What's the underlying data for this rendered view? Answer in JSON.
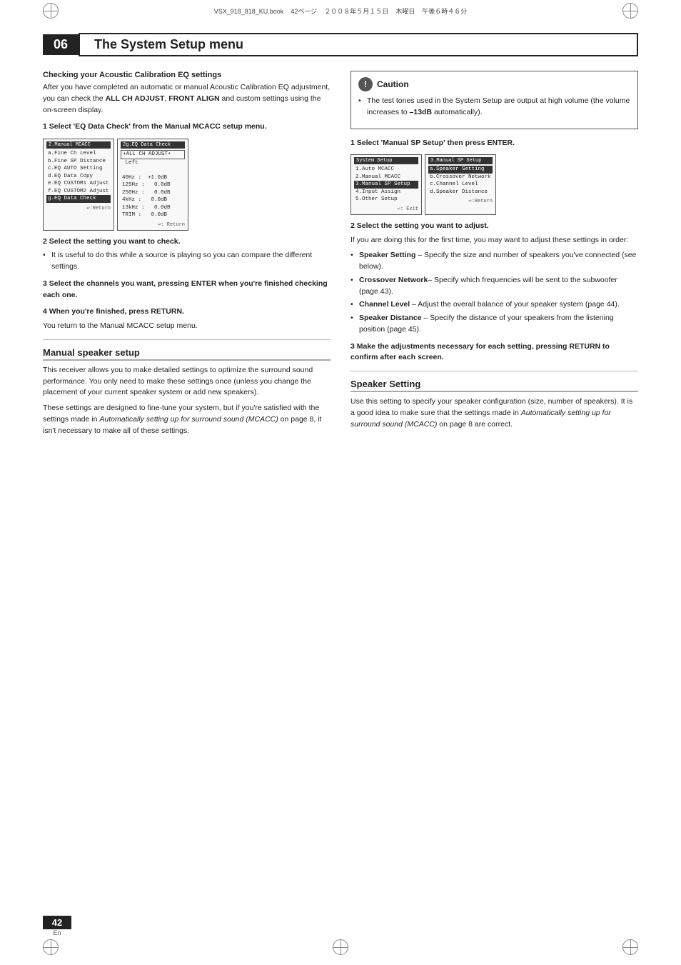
{
  "meta": {
    "filename": "VSX_918_818_KU.book",
    "page": "42ページ",
    "date": "２００８年５月１５日",
    "day": "木曜日",
    "time": "午後６時４６分"
  },
  "chapter": {
    "number": "06",
    "title": "The System Setup menu"
  },
  "left_col": {
    "checking_section": {
      "heading": "Checking your Acoustic Calibration EQ settings",
      "body1": "After you have completed an automatic or manual Acoustic Calibration EQ adjustment, you can check the ",
      "bold1": "ALL CH ADJUST",
      "body1b": ", ",
      "bold2": "FRONT ALIGN",
      "body1c": " and custom settings using the on-screen display.",
      "step1_heading": "1   Select 'EQ Data Check' from the Manual MCACC setup menu.",
      "screen1_title": "2.Manual MCACC",
      "screen1_items": [
        "a.Fine Ch Level",
        "b.Fine SP Distance",
        "c.EQ AUTO Setting",
        "d.EQ Data Copy",
        "e.EQ CUSTOM1 Adjust",
        "f.EQ CUSTOM2 Adjust",
        "g.EQ Data Check"
      ],
      "screen1_selected": "g.EQ Data Check",
      "screen1_footer": "↩:Return",
      "screen2_title": "2g.EQ Data Check",
      "screen2_items": [
        "•ALL CH ADJUST•",
        "Left",
        "",
        "40Hz :  +1.0dB",
        "125Hz :   0.0dB",
        "250Hz :   0.0dB",
        "4kHz :   0.0dB",
        "13kHz :   0.0dB",
        "TRIM :   0.0dB"
      ],
      "screen2_highlighted": "•ALL CH ADJUST•",
      "screen2_footer": "↩: Return",
      "step2_heading": "2   Select the setting you want to check.",
      "step2_bullet": "It is useful to do this while a source is playing so you can compare the different settings.",
      "step3_heading": "3   Select the channels you want, pressing ENTER when you're finished checking each one.",
      "step4_heading": "4   When you're finished, press RETURN.",
      "step4_body": "You return to the Manual MCACC setup menu."
    },
    "manual_speaker_section": {
      "heading": "Manual speaker setup",
      "body1": "This receiver allows you to make detailed settings to optimize the surround sound performance. You only need to make these settings once (unless you change the placement of your current speaker system or add new speakers).",
      "body2": "These settings are designed to fine-tune your system, but if you're satisfied with the settings made in ",
      "italic1": "Automatically setting up for surround sound (MCACC)",
      "body2b": " on page 8, it isn't necessary to make all of these settings."
    }
  },
  "right_col": {
    "caution": {
      "title": "Caution",
      "icon": "!",
      "bullet": "The test tones used in the System Setup are output at high volume (the volume increases to ",
      "bold": "–13dB",
      "bullet_end": " automatically)."
    },
    "step1_heading": "1   Select 'Manual SP Setup' then press ENTER.",
    "screen1_title": "System Setup",
    "screen1_items": [
      "1.Auto MCACC",
      "2.Manual MCACC",
      "3.Manual SP Setup",
      "4.Input Assign",
      "5.Other Setup"
    ],
    "screen1_selected": "3.Manual SP Setup",
    "screen1_footer": "↩: Exit",
    "screen2_title": "3.Manual SP Setup",
    "screen2_items": [
      "a.Speaker Setting",
      "b.Crossover Network",
      "c.Channel Level",
      "d.Speaker Distance"
    ],
    "screen2_selected": "a.Speaker Setting",
    "screen2_footer": "↩:Return",
    "step2_heading": "2   Select the setting you want to adjust.",
    "step2_body": "If you are doing this for the first time, you may want to adjust these settings in order:",
    "bullets": [
      {
        "bold": "Speaker Setting",
        "text": " – Specify the size and number of speakers you've connected (see below)."
      },
      {
        "bold": "Crossover Network",
        "text": "– Specify which frequencies will be sent to the subwoofer (page 43)."
      },
      {
        "bold": "Channel Level",
        "text": " – Adjust the overall balance of your speaker system (page 44)."
      },
      {
        "bold": "Speaker Distance",
        "text": " – Specify the distance of your speakers from the listening position (page 45)."
      }
    ],
    "step3_heading": "3   Make the adjustments necessary for each setting, pressing RETURN to confirm after each screen.",
    "speaker_setting": {
      "heading": "Speaker Setting",
      "body": "Use this setting to specify your speaker configuration (size, number of speakers). It is a good idea to make sure that the settings made in ",
      "italic": "Automatically setting up for surround sound (MCACC)",
      "body_end": " on page 8 are correct."
    }
  },
  "page": {
    "number": "42",
    "lang": "En"
  }
}
